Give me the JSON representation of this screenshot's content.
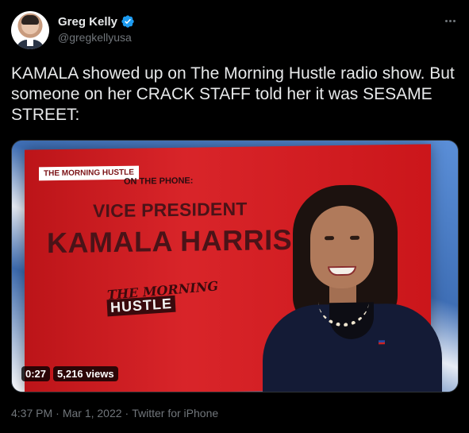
{
  "author": {
    "display_name": "Greg Kelly",
    "handle": "@gregkellyusa"
  },
  "tweet": {
    "text": "KAMALA showed up on The Morning Hustle radio show. But someone on her CRACK STAFF told her it was SESAME STREET:"
  },
  "media": {
    "show_tag": "THE MORNING HUSTLE",
    "on_phone": "ON THE PHONE:",
    "title_line1": "VICE PRESIDENT",
    "title_line2": "KAMALA HARRIS",
    "logo_top": "THE MORNING",
    "logo_bottom": "HUSTLE",
    "duration": "0:27",
    "views": "5,216 views"
  },
  "meta": {
    "time": "4:37 PM",
    "separator": "·",
    "date": "Mar 1, 2022",
    "source": "Twitter for iPhone"
  },
  "colors": {
    "verified": "#1d9bf0",
    "screen_red": "#d6171c",
    "secondary_text": "#71767b"
  },
  "icons": {
    "verified": "verified-badge-icon",
    "more": "more-options-icon"
  }
}
